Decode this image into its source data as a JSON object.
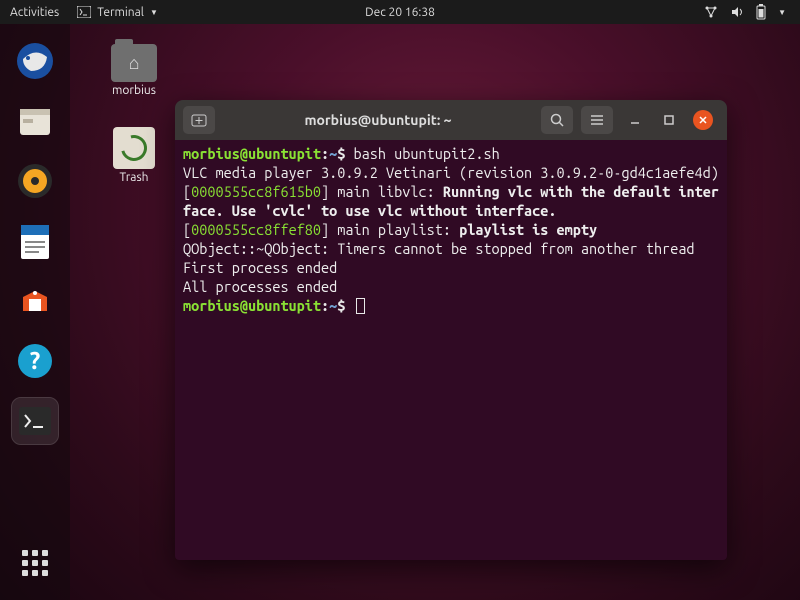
{
  "topbar": {
    "activities": "Activities",
    "app_label": "Terminal",
    "datetime": "Dec 20  16:38"
  },
  "desktop": {
    "folder_label": "morbius",
    "trash_label": "Trash"
  },
  "terminal": {
    "title": "morbius@ubuntupit: ~",
    "prompt_user": "morbius@ubuntupit",
    "prompt_sep": ":",
    "prompt_path": "~",
    "prompt_dollar": "$",
    "command": "bash ubuntupit2.sh",
    "lines": {
      "l1": "VLC media player 3.0.9.2 Vetinari (revision 3.0.9.2-0-gd4c1aefe4d)",
      "l2_addr": "0000555cc8f615b0",
      "l2_a": "] main libvlc: ",
      "l2_b": "Running vlc with the default interface. Use 'cvlc' to use vlc without interface.",
      "l3_addr": "0000555cc8ffef80",
      "l3_a": "] main playlist: ",
      "l3_b": "playlist is empty",
      "l4": "QObject::~QObject: Timers cannot be stopped from another thread",
      "l5": "First process ended",
      "l6": "All processes ended"
    }
  }
}
